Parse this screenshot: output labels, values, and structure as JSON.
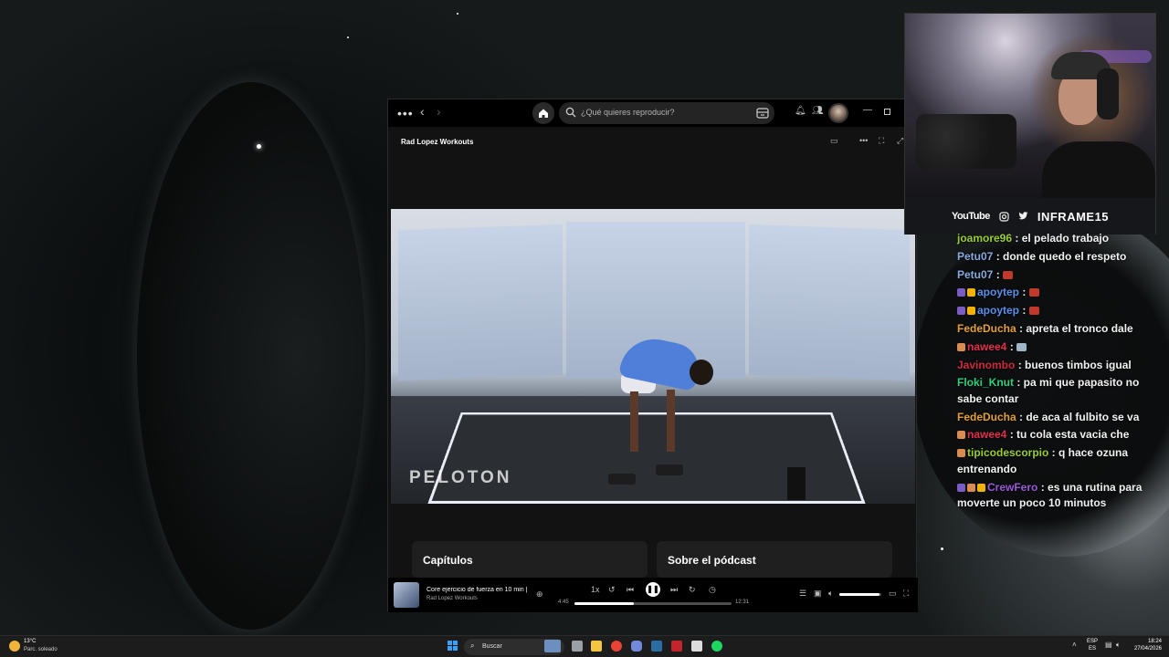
{
  "spotify": {
    "search_placeholder": "¿Qué quieres reproducir?",
    "header_title": "Rad Lopez Workouts",
    "video_watermark": "PELOTON",
    "cards": [
      "Capítulos",
      "Sobre el pódcast"
    ],
    "now_playing": {
      "title": "Core ejercicio de fuerza en 10 min | R",
      "artist": "Rad Lopez Workouts",
      "speed": "1x",
      "elapsed": "4:45",
      "total": "12:31",
      "progress": 0.38,
      "volume": 0.95
    }
  },
  "webcam": {
    "platform_label": "YouTube",
    "handle": "INFRAME15"
  },
  "chat": {
    "messages": [
      {
        "user": "joamore96",
        "text": " : el pelado trabajo",
        "color": "#9acd32",
        "badges": []
      },
      {
        "user": "Petu07",
        "text": " : donde quedo el respeto",
        "color": "#87aade",
        "badges": []
      },
      {
        "user": "Petu07",
        "text": " : ",
        "color": "#87aade",
        "badges": [],
        "emote": "#c0392b"
      },
      {
        "user": "apoytep",
        "text": " : ",
        "color": "#5b8fe8",
        "badges": [
          "#7b5cc4",
          "#f2b200"
        ],
        "emote": "#c0392b"
      },
      {
        "user": "apoytep",
        "text": " : ",
        "color": "#5b8fe8",
        "badges": [
          "#7b5cc4",
          "#f2b200"
        ],
        "emote": "#c0392b"
      },
      {
        "user": "FedeDucha",
        "text": " : apreta el tronco dale",
        "color": "#e3a034",
        "badges": []
      },
      {
        "user": "nawee4",
        "text": " : ",
        "color": "#e0304a",
        "badges": [
          "#d98c52"
        ],
        "emote": "#9fb5c9"
      },
      {
        "user": "Javinombo",
        "text": " : buenos timbos igual",
        "color": "#cc2a3a",
        "badges": []
      },
      {
        "user": "Floki_Knut",
        "text": " : pa mi que papasito no sabe contar",
        "color": "#28d17c",
        "badges": []
      },
      {
        "user": "FedeDucha",
        "text": " : de aca al fulbito se va",
        "color": "#e3a034",
        "badges": []
      },
      {
        "user": "nawee4",
        "text": " : tu cola esta vacia che",
        "color": "#e0304a",
        "badges": [
          "#d98c52"
        ]
      },
      {
        "user": "tipicodescorpio",
        "text": " : q hace ozuna entrenando",
        "color": "#9acd32",
        "badges": [
          "#d98c52"
        ]
      },
      {
        "user": "CrewFero",
        "text": " : es una rutina para moverte un poco 10 minutos",
        "color": "#9b59d6",
        "badges": [
          "#7b5cc4",
          "#d98c52",
          "#f2b200"
        ]
      }
    ]
  },
  "taskbar": {
    "weather_temp": "13°C",
    "weather_desc": "Parc. soleado",
    "search_label": "Buscar",
    "lang_line1": "ESP",
    "lang_line2": "ES",
    "time": "18:24",
    "date": "27/04/2026"
  }
}
